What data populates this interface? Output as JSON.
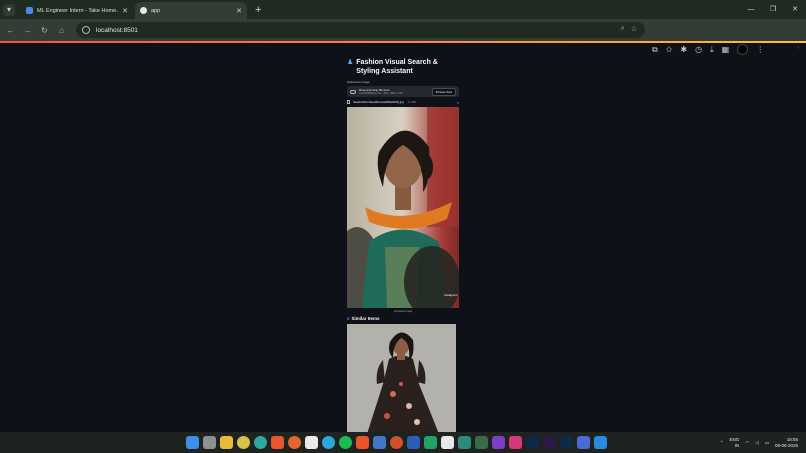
{
  "browser": {
    "tabs": [
      {
        "title": "ML Engineer Intern - Take Home A",
        "active": false,
        "favicon_color": "#4a88f0"
      },
      {
        "title": "app",
        "active": true,
        "favicon_color": "#ffffff"
      }
    ],
    "new_tab_label": "+",
    "url": "localhost:8501",
    "window_controls": {
      "minimize": "—",
      "restore": "❐",
      "close": "✕"
    }
  },
  "app": {
    "menu_dots": "⋮",
    "title": "Fashion Visual Search & Styling Assistant",
    "title_icon": "person-icon",
    "upload_label": "Upload an image",
    "dropzone": {
      "title": "Drag and drop file here",
      "limit": "Limit 200MB per file • JPG, JPEG, PNG",
      "browse_label": "Browse files"
    },
    "uploaded_file": {
      "name": "Sarah23ArchanaSrinivas8RHRR4j.jpg",
      "size": "71.4KB",
      "remove": "×"
    },
    "image_caption": "Uploaded Image",
    "similar_heading": "Similar Items",
    "similar_icon": "magnifier-icon"
  },
  "taskbar": {
    "language_top": "ENG",
    "language_bottom": "IN",
    "time": "18:55",
    "date": "08-06-2025"
  }
}
